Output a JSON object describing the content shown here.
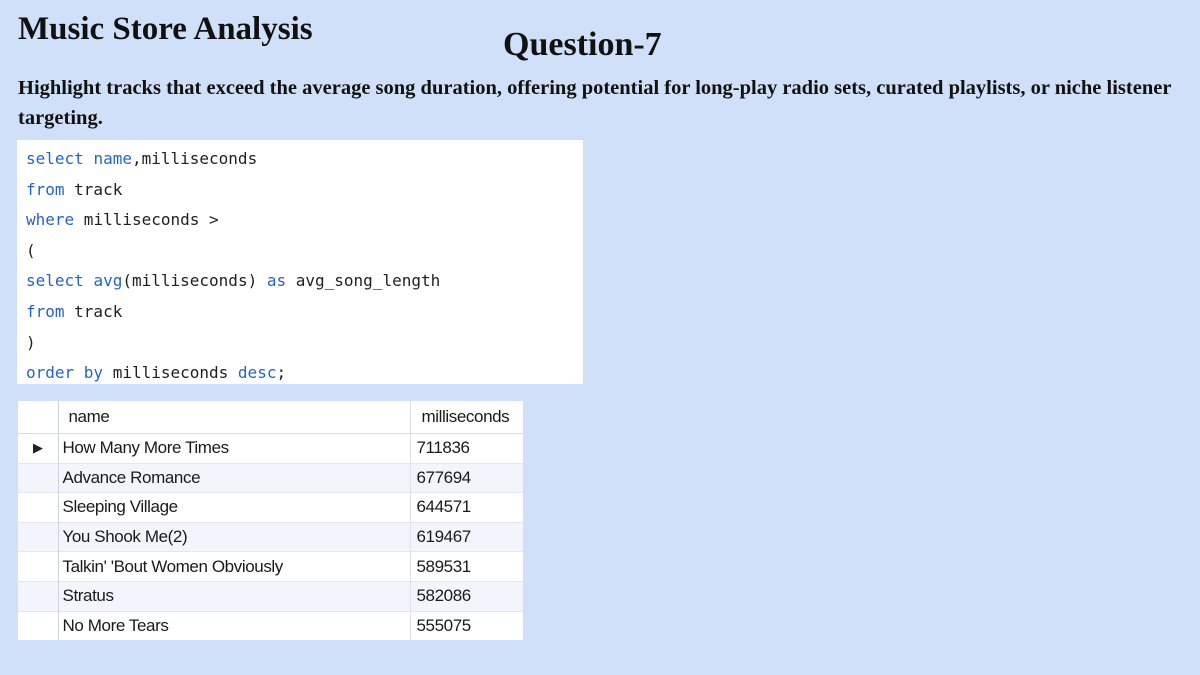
{
  "header": {
    "title": "Music Store Analysis",
    "question": "Question-7",
    "description": "Highlight tracks that exceed the average song duration, offering potential for long-play radio sets, curated playlists, or niche listener targeting."
  },
  "query": {
    "lines": [
      [
        {
          "t": "select",
          "k": "kw"
        },
        {
          "t": " ",
          "k": "ident"
        },
        {
          "t": "name",
          "k": "kw"
        },
        {
          "t": ",milliseconds",
          "k": "ident"
        }
      ],
      [
        {
          "t": "from",
          "k": "kw"
        },
        {
          "t": " track",
          "k": "ident"
        }
      ],
      [
        {
          "t": "where",
          "k": "kw"
        },
        {
          "t": " milliseconds >",
          "k": "ident"
        }
      ],
      [
        {
          "t": "(",
          "k": "ident"
        }
      ],
      [
        {
          "t": "select",
          "k": "kw"
        },
        {
          "t": " ",
          "k": "ident"
        },
        {
          "t": "avg",
          "k": "fn"
        },
        {
          "t": "(milliseconds) ",
          "k": "ident"
        },
        {
          "t": "as",
          "k": "kw"
        },
        {
          "t": " avg_song_length",
          "k": "ident"
        }
      ],
      [
        {
          "t": "from",
          "k": "kw"
        },
        {
          "t": " track",
          "k": "ident"
        }
      ],
      [
        {
          "t": ")",
          "k": "ident"
        }
      ],
      [
        {
          "t": "order by",
          "k": "kw"
        },
        {
          "t": " milliseconds ",
          "k": "ident"
        },
        {
          "t": "desc",
          "k": "kw"
        },
        {
          "t": ";",
          "k": "ident"
        }
      ]
    ]
  },
  "results": {
    "columns": [
      "name",
      "milliseconds"
    ],
    "current_row_marker": "▶",
    "rows": [
      {
        "name": "How Many More Times",
        "milliseconds": "711836"
      },
      {
        "name": "Advance Romance",
        "milliseconds": "677694"
      },
      {
        "name": "Sleeping Village",
        "milliseconds": "644571"
      },
      {
        "name": "You Shook Me(2)",
        "milliseconds": "619467"
      },
      {
        "name": "Talkin' 'Bout Women Obviously",
        "milliseconds": "589531"
      },
      {
        "name": "Stratus",
        "milliseconds": "582086"
      },
      {
        "name": "No More Tears",
        "milliseconds": "555075"
      }
    ]
  },
  "colors": {
    "background": "#cfe0f8",
    "keyword": "#2563c9",
    "code_text": "#1f1f1f"
  }
}
